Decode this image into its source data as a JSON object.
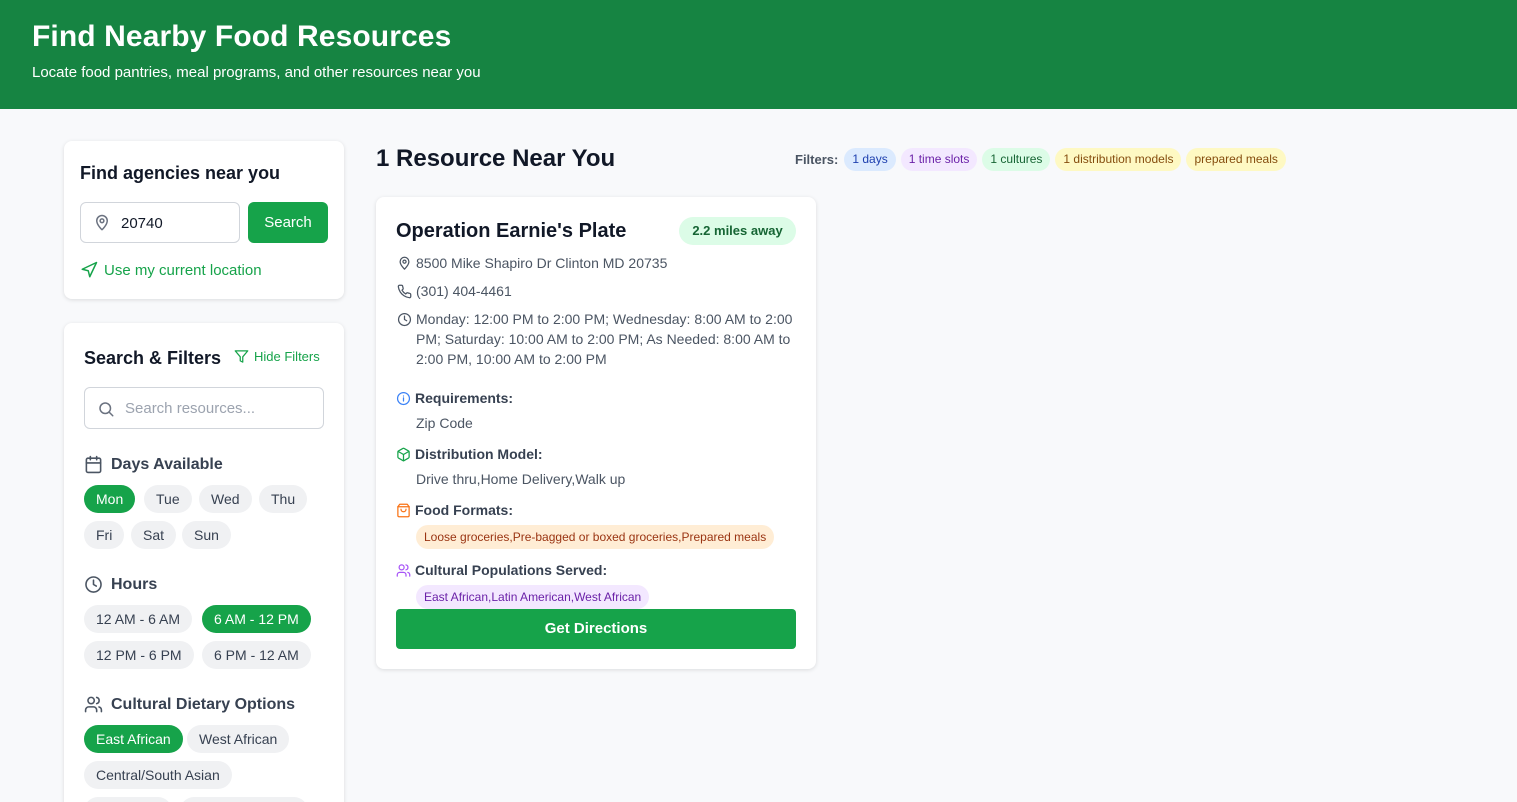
{
  "header": {
    "title": "Find Nearby Food Resources",
    "subtitle": "Locate food pantries, meal programs, and other resources near you"
  },
  "location": {
    "title": "Find agencies near you",
    "zip_value": "20740",
    "search_label": "Search",
    "use_location_label": "Use my current location"
  },
  "filters_panel": {
    "title": "Search & Filters",
    "hide_label": "Hide Filters",
    "search_placeholder": "Search resources...",
    "days": {
      "title": "Days Available",
      "options": [
        "Mon",
        "Tue",
        "Wed",
        "Thu",
        "Fri",
        "Sat",
        "Sun"
      ],
      "selected": [
        "Mon"
      ]
    },
    "hours": {
      "title": "Hours",
      "options": [
        "12 AM - 6 AM",
        "6 AM - 12 PM",
        "12 PM - 6 PM",
        "6 PM - 12 AM"
      ],
      "selected": [
        "6 AM - 12 PM"
      ]
    },
    "cultural": {
      "title": "Cultural Dietary Options",
      "options": [
        "East African",
        "West African",
        "Central/South Asian"
      ],
      "selected": [
        "East African"
      ]
    }
  },
  "results": {
    "title": "1 Resource Near You",
    "filters_label": "Filters:",
    "active_filters": [
      "1 days",
      "1 time slots",
      "1 cultures",
      "1 distribution models",
      "prepared meals"
    ]
  },
  "resource": {
    "name": "Operation Earnie's Plate",
    "distance": "2.2 miles away",
    "address": "8500 Mike Shapiro Dr Clinton MD 20735",
    "phone": "(301) 404-4461",
    "hours_line1": "Monday: 12:00 PM to 2:00 PM; Wednesday: 8:00 AM to 2:00",
    "hours_line2": "PM; Saturday: 10:00 AM to 2:00 PM; As Needed: 8:00 AM to",
    "hours_line3": "2:00 PM, 10:00 AM to 2:00 PM",
    "requirements_label": "Requirements:",
    "requirements": "Zip Code",
    "distribution_label": "Distribution Model:",
    "distribution": "Drive thru,Home Delivery,Walk up",
    "formats_label": "Food Formats:",
    "formats": "Loose groceries,Pre-bagged or boxed groceries,Prepared meals",
    "cultural_label": "Cultural Populations Served:",
    "cultural": "East African,Latin American,West African",
    "directions_label": "Get Directions"
  },
  "colors": {
    "header_green": "#168442",
    "primary_green": "#16a34a"
  }
}
